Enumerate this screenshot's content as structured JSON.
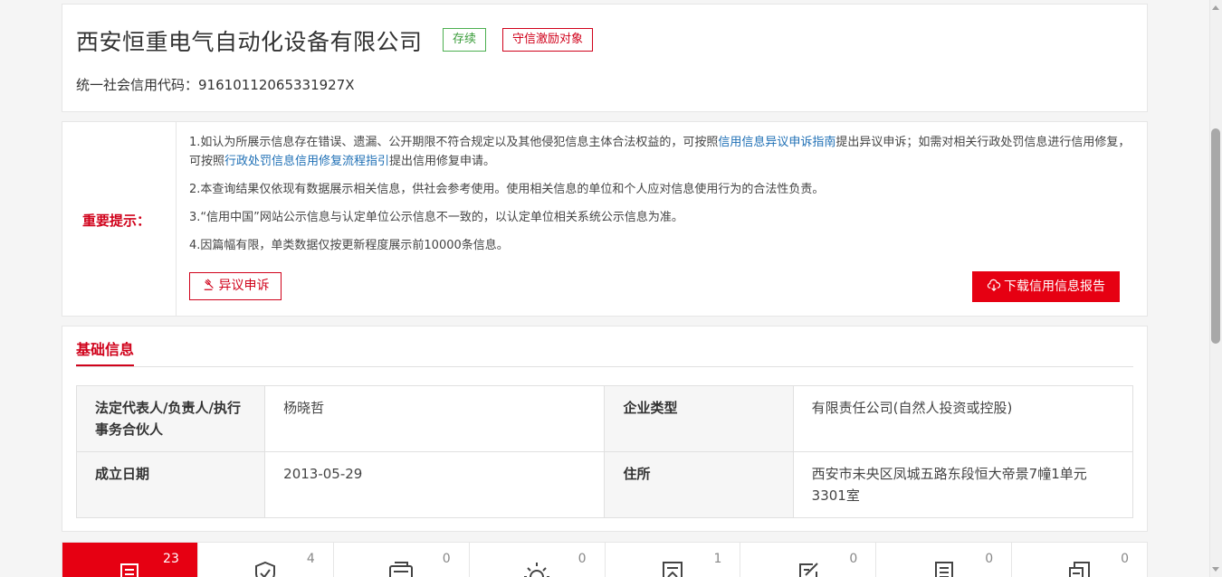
{
  "header": {
    "company_name": "西安恒重电气自动化设备有限公司",
    "status_badge": "存续",
    "incentive_badge": "守信激励对象",
    "credit_code_label": "统一社会信用代码：",
    "credit_code": "91610112065331927X"
  },
  "notice": {
    "label": "重要提示：",
    "line1_a": "1.如认为所展示信息存在错误、遗漏、公开期限不符合规定以及其他侵犯信息主体合法权益的，可按照",
    "line1_link1": "信用信息异议申诉指南",
    "line1_b": "提出异议申诉；如需对相关行政处罚信息进行信用修复，可按照",
    "line1_link2": "行政处罚信息信用修复流程指引",
    "line1_c": "提出信用修复申请。",
    "line2": "2.本查询结果仅依现有数据展示相关信息，供社会参考使用。使用相关信息的单位和个人应对信息使用行为的合法性负责。",
    "line3": "3.“信用中国”网站公示信息与认定单位公示信息不一致的，以认定单位相关系统公示信息为准。",
    "line4": "4.因篇幅有限，单类数据仅按更新程度展示前10000条信息。",
    "objection_button": "异议申诉",
    "download_button": "下载信用信息报告"
  },
  "basic_info": {
    "tab_title": "基础信息",
    "rows": [
      {
        "k1": "法定代表人/负责人/执行事务合伙人",
        "v1": "杨晓哲",
        "k2": "企业类型",
        "v2": "有限责任公司(自然人投资或控股)"
      },
      {
        "k1": "成立日期",
        "v1": "2013-05-29",
        "k2": "住所",
        "v2": "西安市未央区凤城五路东段恒大帝景7幢1单元3301室"
      }
    ]
  },
  "categories": [
    {
      "count": "23",
      "icon": "document-list-icon"
    },
    {
      "count": "4",
      "icon": "shield-check-icon"
    },
    {
      "count": "0",
      "icon": "id-card-icon"
    },
    {
      "count": "0",
      "icon": "lightbulb-icon"
    },
    {
      "count": "1",
      "icon": "certificate-icon"
    },
    {
      "count": "0",
      "icon": "edit-form-icon"
    },
    {
      "count": "0",
      "icon": "document-icon"
    },
    {
      "count": "0",
      "icon": "files-icon"
    }
  ],
  "colors": {
    "accent_red": "#e60012",
    "label_red": "#d0021b",
    "status_green": "#4caf50",
    "link_blue": "#1e6fb5"
  }
}
